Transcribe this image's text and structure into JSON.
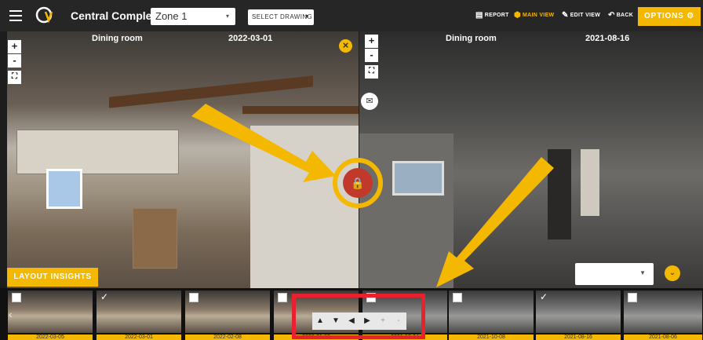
{
  "header": {
    "menu_icon": "hamburger-icon",
    "logo_icon": "qv-logo-icon",
    "project_name": "Central Complex",
    "zone_value": "Zone 1",
    "drawing_label": "SELECT DRAWING",
    "report_label": "REPORT",
    "main_view_label": "MAIN VIEW",
    "edit_view_label": "EDIT VIEW",
    "back_label": "BACK",
    "options_label": "OPTIONS",
    "accent_color": "#f5b800"
  },
  "left_view": {
    "room": "Dining room",
    "date": "2022-03-01"
  },
  "right_view": {
    "room": "Dining room",
    "date": "2021-08-16"
  },
  "zoom": {
    "in": "+",
    "out": "-",
    "fit": "⛶"
  },
  "lock_icon": "lock-icon",
  "layout_insights_label": "LAYOUT INSIGHTS",
  "nav_buttons": [
    "▲",
    "▼",
    "◀",
    "▶",
    "+",
    "-"
  ],
  "thumbnails": [
    {
      "date": "2022-03-05",
      "checked": false
    },
    {
      "date": "2022-03-01",
      "checked": true
    },
    {
      "date": "2022-02-08",
      "checked": false
    },
    {
      "date": "2022-01-15",
      "checked": false
    },
    {
      "date": "2021-12-04",
      "checked": false
    },
    {
      "date": "2021-10-08",
      "checked": false
    },
    {
      "date": "2021-08-16",
      "checked": true
    },
    {
      "date": "2021-08-06",
      "checked": false
    }
  ],
  "highlight_color": "#e8212e"
}
